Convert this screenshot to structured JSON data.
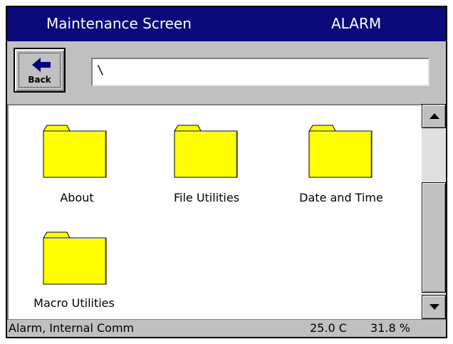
{
  "titlebar": {
    "title": "Maintenance Screen",
    "status": "ALARM"
  },
  "toolbar": {
    "back_label": "Back",
    "path_value": "\\"
  },
  "folders": [
    {
      "label": "About",
      "icon": "folder-icon"
    },
    {
      "label": "File Utilities",
      "icon": "folder-icon"
    },
    {
      "label": "Date and Time",
      "icon": "folder-icon"
    },
    {
      "label": "Macro Utilities",
      "icon": "folder-icon"
    }
  ],
  "statusbar": {
    "message": "Alarm, Internal Comm",
    "temperature": "25.0 C",
    "humidity": "31.8 %"
  },
  "colors": {
    "titlebar": "#0a0a7a",
    "folder": "#ffff00",
    "chrome": "#c0c0c0"
  }
}
